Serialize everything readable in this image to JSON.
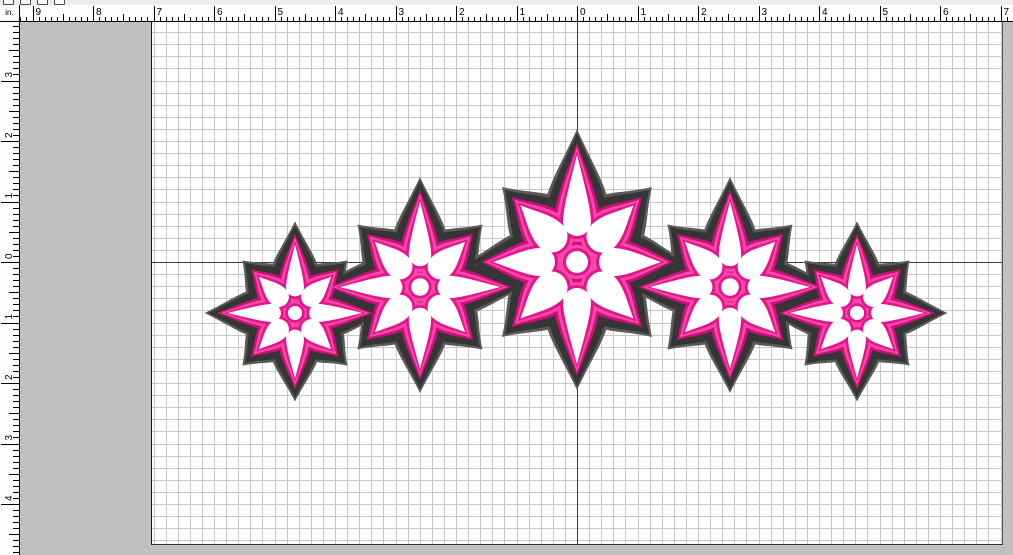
{
  "app": {
    "units_label": "in."
  },
  "toolbar": {
    "icons": [
      "new-document-icon",
      "open-folder-icon",
      "save-icon",
      "print-icon"
    ]
  },
  "ruler_top": {
    "labels": [
      "9",
      "8",
      "7",
      "6",
      "5",
      "4",
      "3",
      "2",
      "1",
      "0",
      "1",
      "2",
      "3",
      "4",
      "5",
      "6",
      "7"
    ]
  },
  "ruler_left": {
    "labels": [
      "3",
      "2",
      "1",
      "0",
      "1",
      "2",
      "3",
      "4"
    ]
  },
  "workspace": {
    "background": "#c0c0c0"
  },
  "canvas": {
    "background": "#ffffff",
    "grid_color": "#c8c8c8",
    "axis_color": "#3c3c3c"
  },
  "design": {
    "colors": {
      "outline_edge": "#5a5a5a",
      "outline": "#353535",
      "thread_shadow": "#cc0f79",
      "thread_highlight": "#f84aa8",
      "thread": "#e6148c",
      "cutout": "#ffffff"
    }
  }
}
